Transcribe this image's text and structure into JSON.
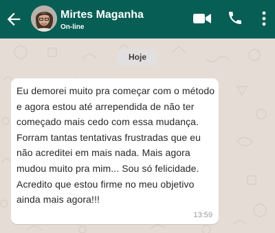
{
  "header": {
    "contact_name": "Mirtes Maganha",
    "status": "On-line",
    "background_color": "#075e54"
  },
  "icons": {
    "back": "arrow-left-icon",
    "video": "video-camera-icon",
    "call": "phone-icon",
    "menu": "more-vertical-icon"
  },
  "chat": {
    "date_label": "Hoje",
    "background_color": "#e5ddd5",
    "messages": [
      {
        "text": "Eu demorei muito pra começar com o método e agora estou até arrependida de não ter começado mais cedo com essa mudança. Forram tantas tentativas frustradas que eu não acreditei em mais nada. Mais agora mudou muito pra mim... Sou só felicidade. Acredito que estou firme no meu objetivo ainda mais agora!!!",
        "time": "13:59"
      }
    ]
  }
}
